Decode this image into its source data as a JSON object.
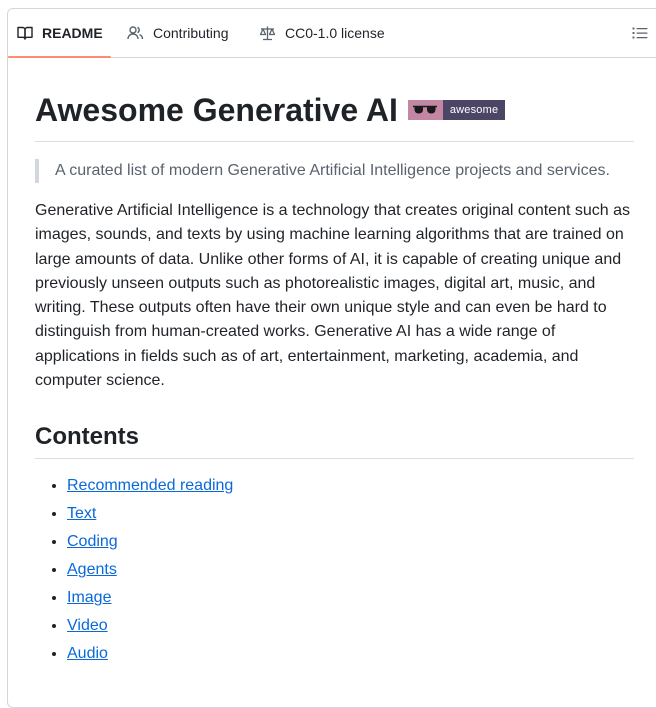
{
  "tabs": [
    {
      "label": "README",
      "icon": "book-icon",
      "active": true
    },
    {
      "label": "Contributing",
      "icon": "people-icon",
      "active": false
    },
    {
      "label": "CC0-1.0 license",
      "icon": "law-scale-icon",
      "active": false
    }
  ],
  "outline_icon": "list-unordered-icon",
  "readme": {
    "title": "Awesome Generative AI",
    "badge": {
      "icon": "sunglasses-icon",
      "text": "awesome",
      "left_color": "#c387a4",
      "right_color": "#4c4566"
    },
    "tagline": "A curated list of modern Generative Artificial Intelligence projects and services.",
    "intro": "Generative Artificial Intelligence is a technology that creates original content such as images, sounds, and texts by using machine learning algorithms that are trained on large amounts of data. Unlike other forms of AI, it is capable of creating unique and previously unseen outputs such as photorealistic images, digital art, music, and writing. These outputs often have their own unique style and can even be hard to distinguish from human-created works. Generative AI has a wide range of applications in fields such as of art, entertainment, marketing, academia, and computer science.",
    "contents_heading": "Contents",
    "contents": [
      "Recommended reading",
      "Text",
      "Coding",
      "Agents",
      "Image",
      "Video",
      "Audio"
    ]
  },
  "colors": {
    "tab_underline": "#fd8c73",
    "link": "#0969da",
    "border": "#d0d7de"
  }
}
